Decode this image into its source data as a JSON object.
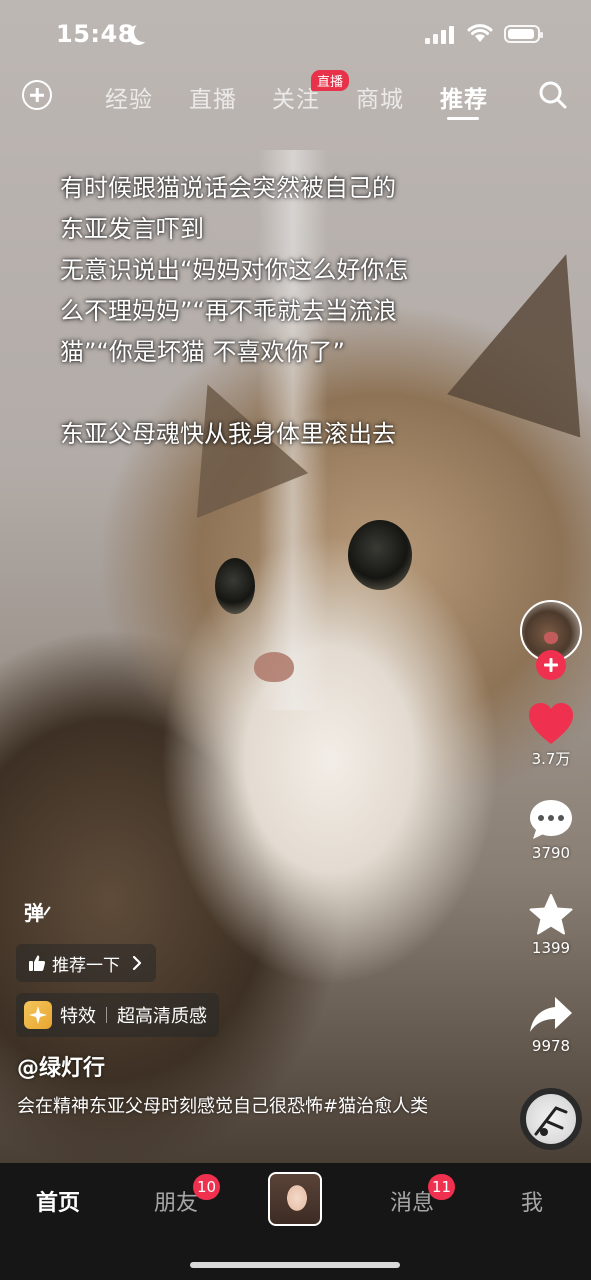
{
  "status": {
    "time": "15:48"
  },
  "topnav": {
    "tabs": [
      "经验",
      "直播",
      "关注",
      "商城",
      "推荐"
    ],
    "active_tab": "推荐",
    "live_badge": "直播"
  },
  "caption": {
    "lines": [
      "有时候跟猫说话会突然被自己的",
      "东亚发言吓到",
      "无意识说出“妈妈对你这么好你怎",
      "么不理妈妈”“再不乖就去当流浪",
      "猫”“你是坏猫 不喜欢你了”"
    ],
    "last_line": "东亚父母魂快从我身体里滚出去"
  },
  "rail": {
    "likes": "3.7万",
    "comments": "3790",
    "favorites": "1399",
    "shares": "9978"
  },
  "overlay": {
    "danmu": "弹",
    "recommend_label": "推荐一下",
    "effect_label": "特效",
    "effect_name": "超高清质感",
    "author": "@绿灯行",
    "description": "会在精神东亚父母时刻感觉自己很恐怖#猫治愈人类"
  },
  "bottom_nav": {
    "home": "首页",
    "friends": "朋友",
    "friends_badge": "10",
    "messages": "消息",
    "messages_badge": "11",
    "me": "我"
  },
  "colors": {
    "accent": "#f0304f",
    "heart": "#f0304f",
    "bar_bg": "#161616"
  }
}
